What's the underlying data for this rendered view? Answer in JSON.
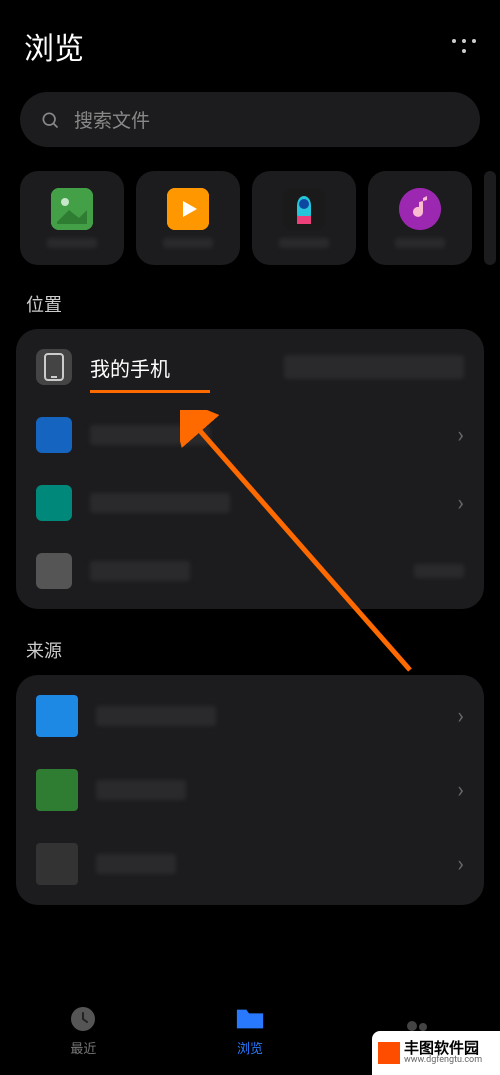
{
  "header": {
    "title": "浏览"
  },
  "search": {
    "placeholder": "搜索文件"
  },
  "sections": {
    "locations": "位置",
    "sources": "来源"
  },
  "locations": {
    "items": [
      {
        "label": "我的手机"
      }
    ]
  },
  "bottomnav": {
    "recent": "最近",
    "browse": "浏览"
  },
  "watermark": {
    "name": "丰图软件园",
    "url": "www.dgfengtu.com"
  }
}
